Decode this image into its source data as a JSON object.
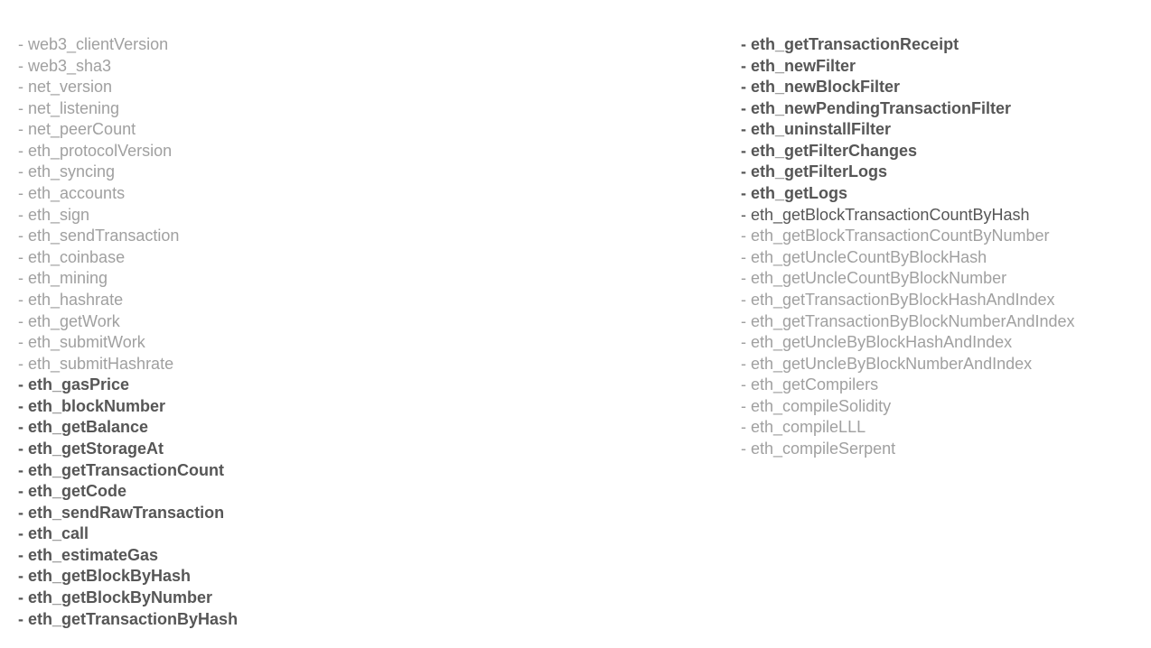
{
  "left": [
    {
      "text": "- web3_clientVersion",
      "style": "gray"
    },
    {
      "text": "- web3_sha3",
      "style": "gray"
    },
    {
      "text": "- net_version",
      "style": "gray"
    },
    {
      "text": "- net_listening",
      "style": "gray"
    },
    {
      "text": "- net_peerCount",
      "style": "gray"
    },
    {
      "text": "- eth_protocolVersion",
      "style": "gray"
    },
    {
      "text": "- eth_syncing",
      "style": "gray"
    },
    {
      "text": "- eth_accounts",
      "style": "gray"
    },
    {
      "text": "- eth_sign",
      "style": "gray"
    },
    {
      "text": "- eth_sendTransaction",
      "style": "gray"
    },
    {
      "text": "- eth_coinbase",
      "style": "gray"
    },
    {
      "text": "- eth_mining",
      "style": "gray"
    },
    {
      "text": "- eth_hashrate",
      "style": "gray"
    },
    {
      "text": "- eth_getWork",
      "style": "gray"
    },
    {
      "text": "- eth_submitWork",
      "style": "gray"
    },
    {
      "text": "- eth_submitHashrate",
      "style": "gray"
    },
    {
      "text": "- eth_gasPrice",
      "style": "bold"
    },
    {
      "text": "- eth_blockNumber",
      "style": "bold"
    },
    {
      "text": "- eth_getBalance",
      "style": "bold"
    },
    {
      "text": "- eth_getStorageAt",
      "style": "bold"
    },
    {
      "text": "- eth_getTransactionCount",
      "style": "bold"
    },
    {
      "text": "- eth_getCode",
      "style": "bold"
    },
    {
      "text": "- eth_sendRawTransaction",
      "style": "bold"
    },
    {
      "text": "- eth_call",
      "style": "bold"
    },
    {
      "text": "- eth_estimateGas",
      "style": "bold"
    },
    {
      "text": "- eth_getBlockByHash",
      "style": "bold"
    },
    {
      "text": "- eth_getBlockByNumber",
      "style": "bold"
    },
    {
      "text": "- eth_getTransactionByHash",
      "style": "bold"
    }
  ],
  "right": [
    {
      "text": "- eth_getTransactionReceipt",
      "style": "bold"
    },
    {
      "text": "- eth_newFilter",
      "style": "bold"
    },
    {
      "text": "- eth_newBlockFilter",
      "style": "bold"
    },
    {
      "text": "- eth_newPendingTransactionFilter",
      "style": "bold"
    },
    {
      "text": "- eth_uninstallFilter",
      "style": "bold"
    },
    {
      "text": "- eth_getFilterChanges",
      "style": "bold"
    },
    {
      "text": "- eth_getFilterLogs",
      "style": "bold"
    },
    {
      "text": "- eth_getLogs",
      "style": "bold"
    },
    {
      "text": "- eth_getBlockTransactionCountByHash",
      "style": "dark"
    },
    {
      "text": "- eth_getBlockTransactionCountByNumber",
      "style": "gray"
    },
    {
      "text": "- eth_getUncleCountByBlockHash",
      "style": "gray"
    },
    {
      "text": "- eth_getUncleCountByBlockNumber",
      "style": "gray"
    },
    {
      "text": "- eth_getTransactionByBlockHashAndIndex",
      "style": "gray"
    },
    {
      "text": "- eth_getTransactionByBlockNumberAndIndex",
      "style": "gray"
    },
    {
      "text": "- eth_getUncleByBlockHashAndIndex",
      "style": "gray"
    },
    {
      "text": "- eth_getUncleByBlockNumberAndIndex",
      "style": "gray"
    },
    {
      "text": "- eth_getCompilers",
      "style": "gray"
    },
    {
      "text": "- eth_compileSolidity",
      "style": "gray"
    },
    {
      "text": "- eth_compileLLL",
      "style": "gray"
    },
    {
      "text": "- eth_compileSerpent",
      "style": "gray"
    }
  ]
}
